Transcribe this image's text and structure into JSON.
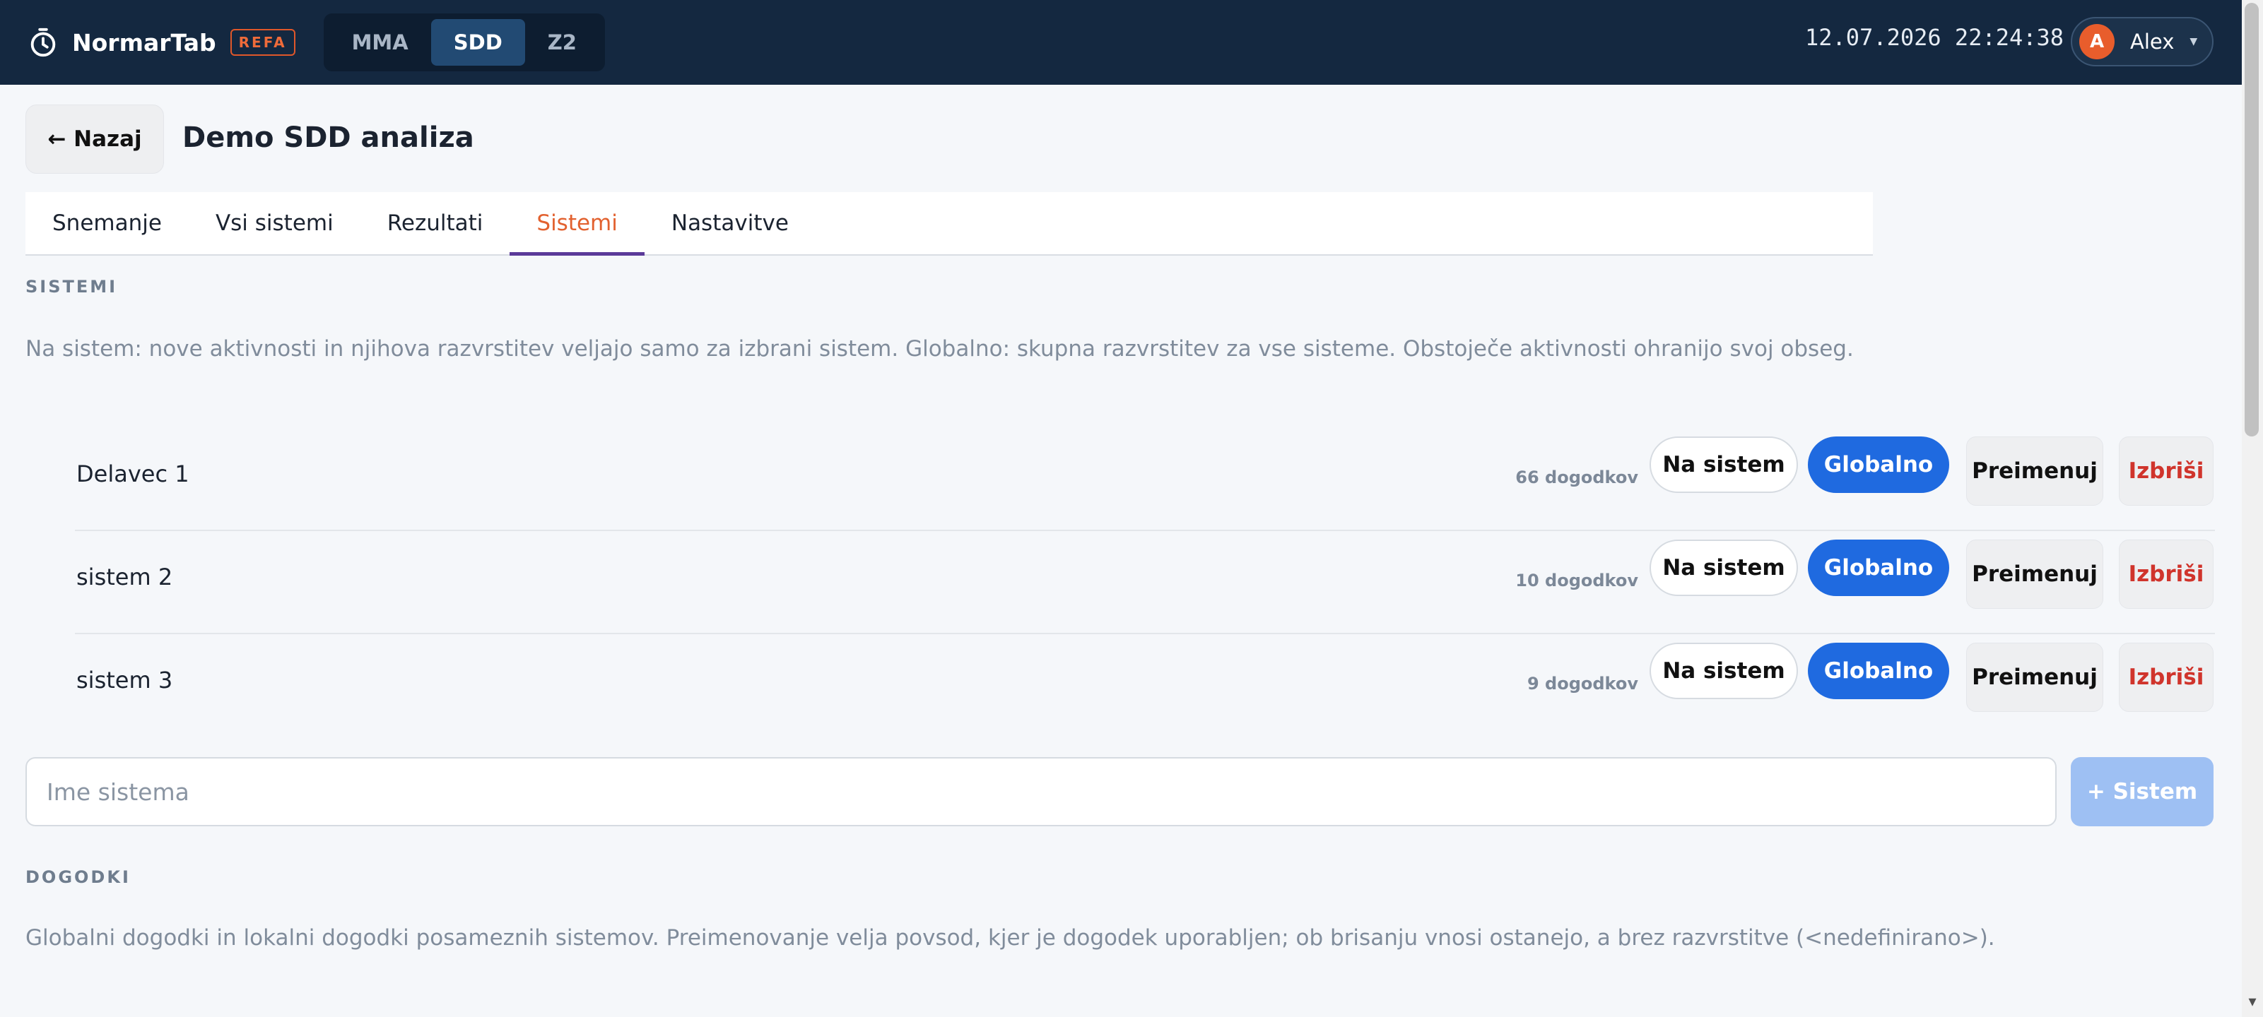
{
  "app": {
    "name": "NormarTab",
    "badge": "REFA",
    "modes": [
      "MMA",
      "SDD",
      "Z2"
    ],
    "active_mode": "SDD",
    "datetime": "12.07.2026 22:24:38",
    "user": {
      "initial": "A",
      "name": "Alex"
    }
  },
  "header": {
    "back_label": "← Nazaj",
    "title": "Demo SDD analiza"
  },
  "tabs": [
    {
      "label": "Snemanje",
      "active": false
    },
    {
      "label": "Vsi sistemi",
      "active": false
    },
    {
      "label": "Rezultati",
      "active": false
    },
    {
      "label": "Sistemi",
      "active": true
    },
    {
      "label": "Nastavitve",
      "active": false
    }
  ],
  "systems_section": {
    "label": "SISTEMI",
    "description": "Na sistem: nove aktivnosti in njihova razvrstitev veljajo samo za izbrani sistem. Globalno: skupna razvrstitev za vse sisteme. Obstoječe aktivnosti ohranijo svoj obseg.",
    "local_label": "Na sistem",
    "global_label": "Globalno",
    "rename_label": "Preimenuj",
    "delete_label": "Izbriši",
    "items": [
      {
        "name": "Delavec 1",
        "count": "66 dogodkov"
      },
      {
        "name": "sistem 2",
        "count": "10 dogodkov"
      },
      {
        "name": "sistem 3",
        "count": "9 dogodkov"
      }
    ],
    "input_placeholder": "Ime sistema",
    "add_label": "+ Sistem"
  },
  "events_section": {
    "label": "DOGODKI",
    "description": "Globalni dogodki in lokalni dogodki posameznih sistemov. Preimenovanje velja povsod, kjer je dogodek uporabljen; ob brisanju vnosi ostanejo, a brez razvrstitve (<nedefinirano>)."
  },
  "colors": {
    "topbar": "#142840",
    "accent_orange": "#e2612f",
    "tab_underline": "#5b3a99",
    "primary_blue": "#1f6ae0",
    "danger_red": "#d0342c"
  },
  "icons": {
    "brand": "stopwatch-icon",
    "user_menu": "caret-down-icon",
    "scroll": "scroll-down-arrow-icon"
  }
}
